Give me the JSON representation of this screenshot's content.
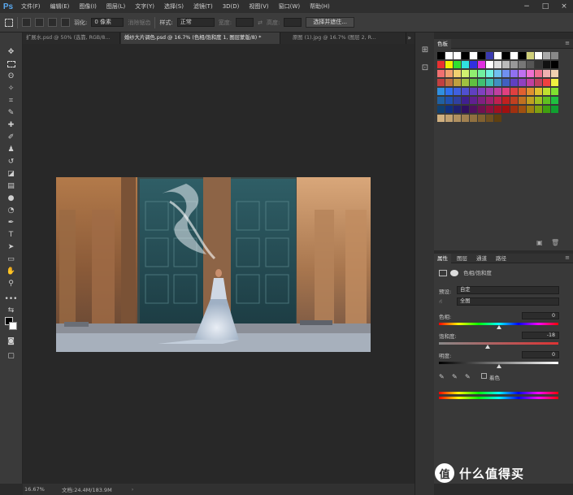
{
  "app": {
    "logo": "Ps"
  },
  "menu": [
    "文件(F)",
    "编辑(E)",
    "图像(I)",
    "图层(L)",
    "文字(Y)",
    "选择(S)",
    "滤镜(T)",
    "3D(D)",
    "视图(V)",
    "窗口(W)",
    "帮助(H)"
  ],
  "window_controls": [
    "−",
    "□",
    "×"
  ],
  "options": {
    "feather_label": "羽化:",
    "feather_value": "0 像素",
    "antialias_label": "消除锯齿",
    "style_label": "样式:",
    "style_value": "正常",
    "width_label": "宽度:",
    "height_label": "高度:",
    "select_mask_button": "选择并遮住..."
  },
  "tabs": [
    {
      "label": "扩展水.psd @ 50% (选靠, RGB/8...",
      "active": false
    },
    {
      "label": "婚纱大片调色.psd @ 16.7% (色相/饱和度 1, 图层蒙版/8) *",
      "active": true
    },
    {
      "label": "原图 (1).jpg @ 16.7% (图层 2, R...",
      "active": false
    }
  ],
  "status": {
    "zoom": "16.67%",
    "doc": "文档:24.4M/183.9M"
  },
  "swatches_panel": {
    "title": "色板"
  },
  "properties_panel": {
    "tabs": [
      "属性",
      "图层",
      "通道",
      "路径"
    ],
    "adjustment_title": "色相/饱和度",
    "preset_label": "预设:",
    "preset_value": "自定",
    "channel_value": "全图",
    "hue_label": "色相:",
    "hue_value": "0",
    "saturation_label": "饱和度:",
    "saturation_value": "-18",
    "lightness_label": "明度:",
    "lightness_value": "0",
    "colorize_label": "着色"
  },
  "watermark": {
    "badge": "值",
    "text": "什么值得买"
  },
  "colors": {
    "accent": "#5aa9f0",
    "panel": "#393939",
    "canvas": "#282828"
  }
}
